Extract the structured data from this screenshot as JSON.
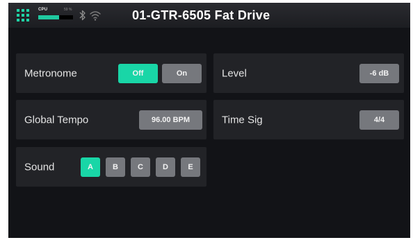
{
  "header": {
    "title": "01-GTR-6505 Fat Drive",
    "cpu_label": "CPU",
    "cpu_percent_text": "59 %",
    "cpu_level": 0.59,
    "icons": [
      "grid-menu-icon",
      "bluetooth-icon",
      "wifi-icon"
    ]
  },
  "settings": {
    "metronome": {
      "label": "Metronome",
      "options": [
        "Off",
        "On"
      ],
      "selected": "Off"
    },
    "level": {
      "label": "Level",
      "value": "-6 dB"
    },
    "global_tempo": {
      "label": "Global Tempo",
      "value": "96.00 BPM"
    },
    "time_sig": {
      "label": "Time Sig",
      "value": "4/4"
    },
    "sound": {
      "label": "Sound",
      "options": [
        "A",
        "B",
        "C",
        "D",
        "E"
      ],
      "selected": "A"
    }
  },
  "colors": {
    "accent": "#19d6a7",
    "panel": "#222327",
    "background": "#121317",
    "button_inactive": "#76787d"
  }
}
